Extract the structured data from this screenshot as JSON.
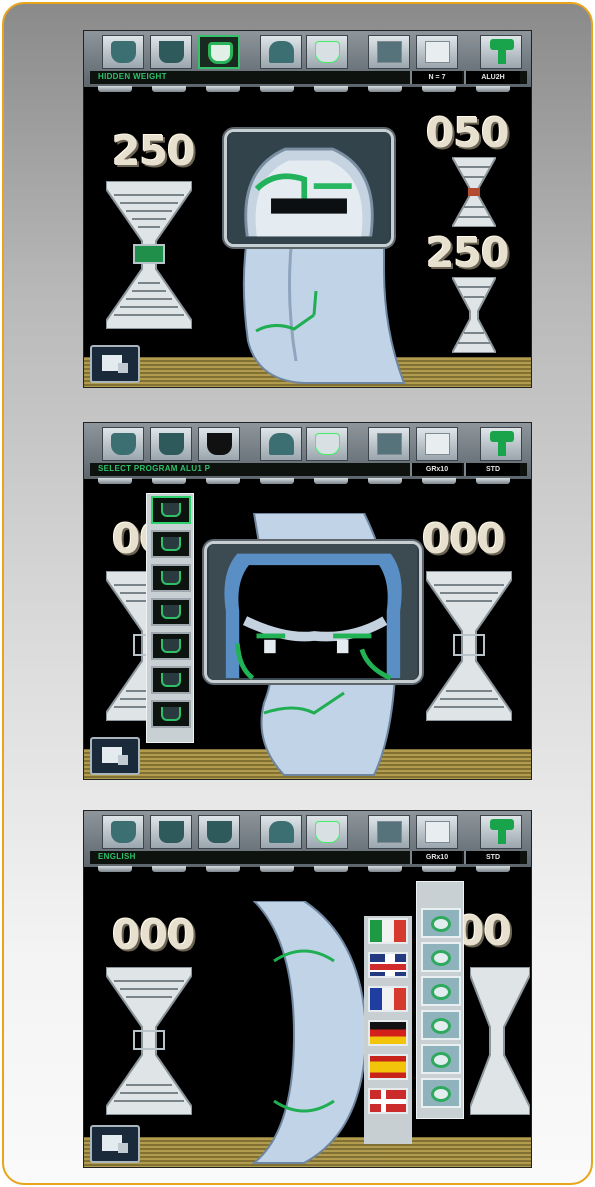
{
  "screens": [
    {
      "status": {
        "message": "HIDDEN WEIGHT",
        "field_a": "N = 7",
        "field_b": "ALU2H"
      },
      "weights": {
        "left": "250",
        "right_top": "050",
        "right_bottom": "250"
      }
    },
    {
      "status": {
        "message": "SELECT PROGRAM ALU1 P",
        "field_a": "GRx10",
        "field_b": "STD"
      },
      "weights": {
        "left_partial": "00",
        "right": "000"
      }
    },
    {
      "status": {
        "message": "ENGLISH",
        "field_a": "GRx10",
        "field_b": "STD"
      },
      "weights": {
        "left": "000",
        "right_partial": "00"
      },
      "languages": [
        "italian-flag",
        "uk-flag",
        "french-flag",
        "german-flag",
        "spanish-flag",
        "danish-flag"
      ]
    }
  ],
  "icons": {
    "toolbar": [
      "tyre-icon",
      "rim-icon",
      "wheel-profile-icon",
      "car-icon",
      "measure-icon",
      "gallery-icon",
      "document-icon",
      "help-icon"
    ],
    "corner": "machine-icon"
  },
  "colors": {
    "frame_border": "#e8a51b",
    "status_green": "#2ec16a",
    "screen_bg": "#000000"
  }
}
